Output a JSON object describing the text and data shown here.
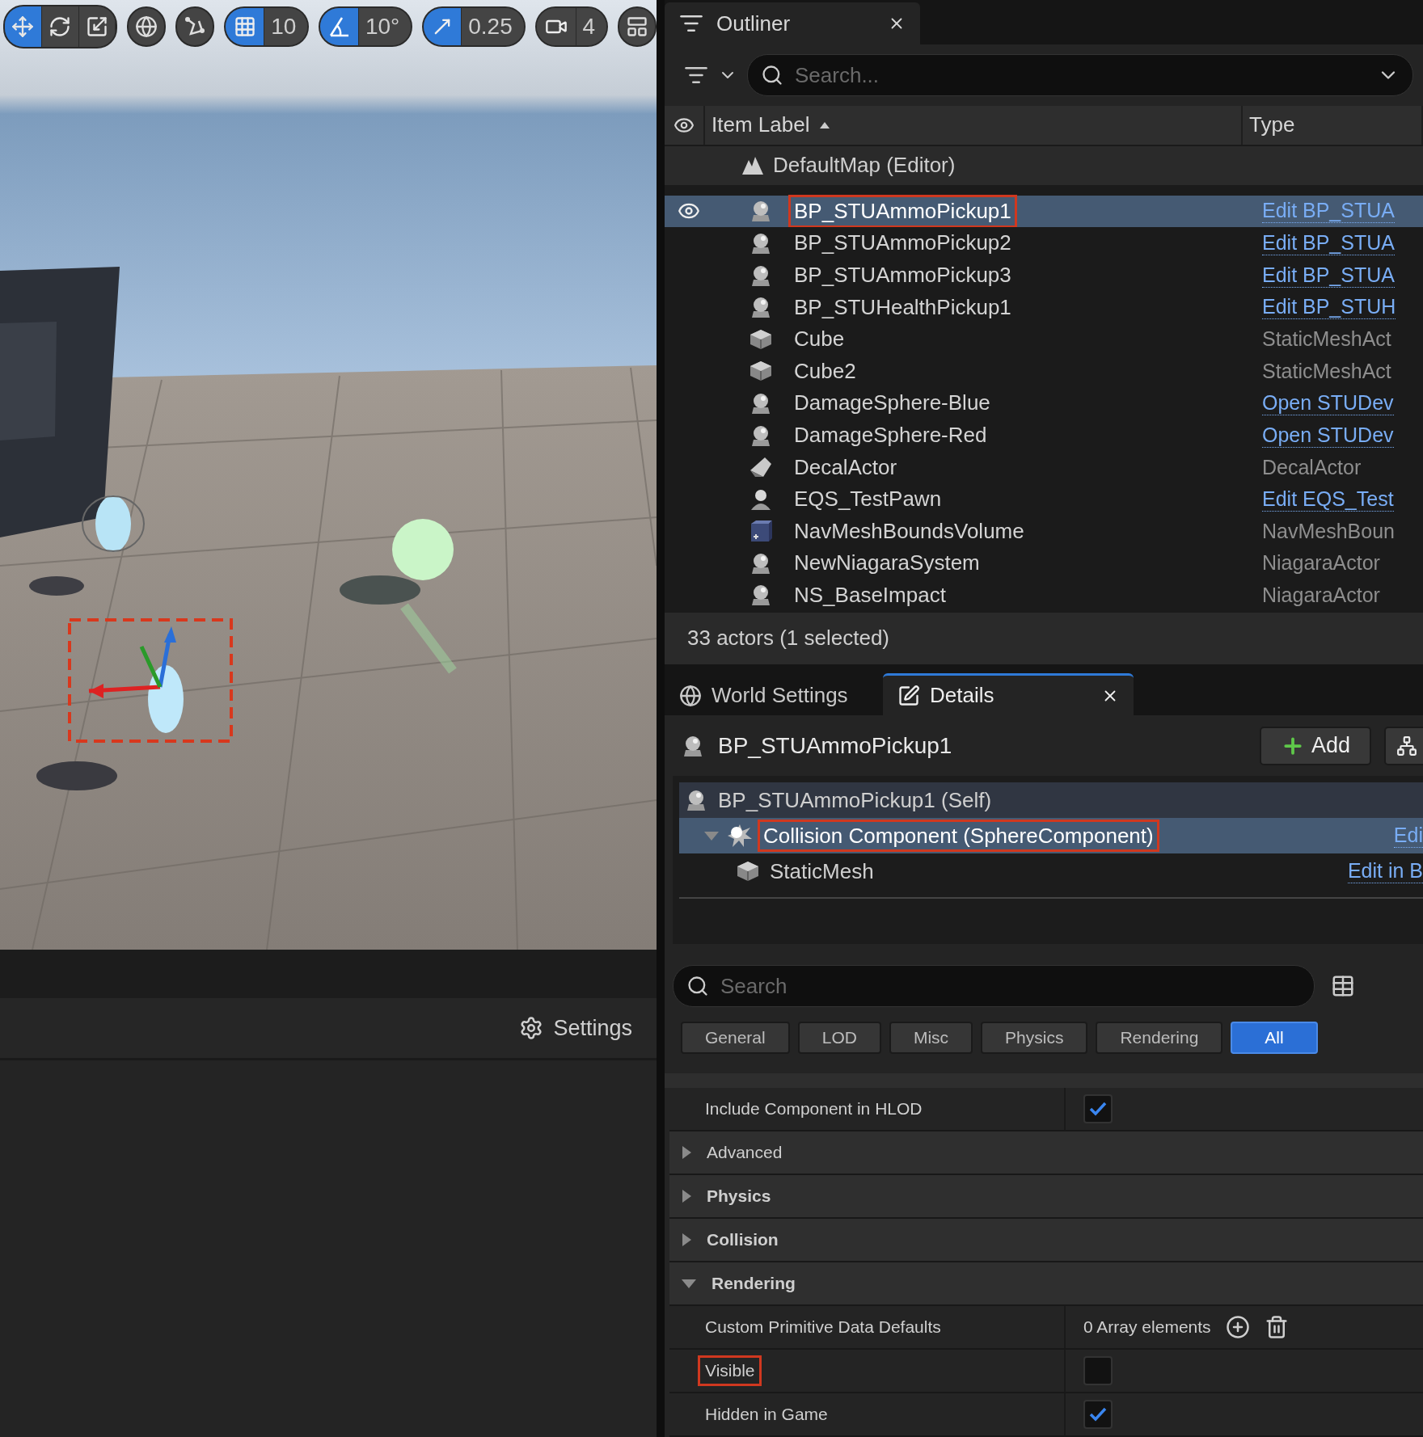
{
  "toolbar": [
    {
      "kind": "modes",
      "items": [
        {
          "selected": true
        },
        {
          "selected": false
        },
        {
          "selected": false
        }
      ]
    },
    {
      "kind": "single"
    },
    {
      "kind": "single"
    },
    {
      "kind": "snap",
      "on": true,
      "value": "10"
    },
    {
      "kind": "snap",
      "on": true,
      "value": "10°"
    },
    {
      "kind": "snap",
      "on": true,
      "value": "0.25"
    },
    {
      "kind": "snap",
      "on": false,
      "value": "4"
    },
    {
      "kind": "single"
    }
  ],
  "viewport_footer": {
    "settings": "Settings"
  },
  "outliner": {
    "tab": "Outliner",
    "search": {
      "placeholder": "Search..."
    },
    "columns": [
      "Item Label",
      "Type"
    ],
    "world": "DefaultMap (Editor)",
    "rows": [
      {
        "kind": "actor",
        "label": "BP_STUAmmoPickup1",
        "type": "Edit BP_STUA",
        "link": true,
        "selected": true,
        "highlighted": true
      },
      {
        "kind": "actor",
        "label": "BP_STUAmmoPickup2",
        "type": "Edit BP_STUA",
        "link": true,
        "selected": false,
        "highlighted": false
      },
      {
        "kind": "actor",
        "label": "BP_STUAmmoPickup3",
        "type": "Edit BP_STUA",
        "link": true,
        "selected": false,
        "highlighted": false
      },
      {
        "kind": "actor",
        "label": "BP_STUHealthPickup1",
        "type": "Edit BP_STUH",
        "link": true,
        "selected": false,
        "highlighted": false
      },
      {
        "kind": "mesh",
        "label": "Cube",
        "type": "StaticMeshAct",
        "link": false,
        "selected": false,
        "highlighted": false
      },
      {
        "kind": "mesh",
        "label": "Cube2",
        "type": "StaticMeshAct",
        "link": false,
        "selected": false,
        "highlighted": false
      },
      {
        "kind": "actor",
        "label": "DamageSphere-Blue",
        "type": "Open STUDev",
        "link": true,
        "selected": false,
        "highlighted": false
      },
      {
        "kind": "actor",
        "label": "DamageSphere-Red",
        "type": "Open STUDev",
        "link": true,
        "selected": false,
        "highlighted": false
      },
      {
        "kind": "decal",
        "label": "DecalActor",
        "type": "DecalActor",
        "link": false,
        "selected": false,
        "highlighted": false
      },
      {
        "kind": "pawn",
        "label": "EQS_TestPawn",
        "type": "Edit EQS_Test",
        "link": true,
        "selected": false,
        "highlighted": false
      },
      {
        "kind": "volume",
        "label": "NavMeshBoundsVolume",
        "type": "NavMeshBoun",
        "link": false,
        "selected": false,
        "highlighted": false
      },
      {
        "kind": "actor",
        "label": "NewNiagaraSystem",
        "type": "NiagaraActor",
        "link": false,
        "selected": false,
        "highlighted": false
      },
      {
        "kind": "actor",
        "label": "NS_BaseImpact",
        "type": "NiagaraActor",
        "link": false,
        "selected": false,
        "highlighted": false
      }
    ],
    "status": "33 actors (1 selected)"
  },
  "details": {
    "tabs": [
      {
        "label": "World Settings",
        "selected": false
      },
      {
        "label": "Details",
        "selected": true
      }
    ],
    "actor": "BP_STUAmmoPickup1",
    "add_button": "Add",
    "components": [
      {
        "kind": "actor",
        "label": "BP_STUAmmoPickup1 (Self)",
        "selected": false,
        "highlighted": false
      },
      {
        "kind": "sphere",
        "label": "Collision Component (SphereComponent)",
        "link": "Edi",
        "selected": true,
        "highlighted": true,
        "expanded": true
      },
      {
        "kind": "mesh",
        "label": "StaticMesh",
        "link": "Edit in B",
        "selected": false,
        "highlighted": false
      }
    ],
    "search": {
      "placeholder": "Search"
    },
    "filters": [
      {
        "label": "General",
        "selected": false
      },
      {
        "label": "LOD",
        "selected": false
      },
      {
        "label": "Misc",
        "selected": false
      },
      {
        "label": "Physics",
        "selected": false
      },
      {
        "label": "Rendering",
        "selected": false
      },
      {
        "label": "All",
        "selected": true
      }
    ],
    "properties": [
      {
        "kind": "checkbox",
        "label": "Include Component in HLOD",
        "checked": true,
        "highlighted": false
      },
      {
        "kind": "category",
        "label": "Advanced",
        "expanded": false,
        "bold": false
      },
      {
        "kind": "category",
        "label": "Physics",
        "expanded": false,
        "bold": true
      },
      {
        "kind": "category",
        "label": "Collision",
        "expanded": false,
        "bold": true
      },
      {
        "kind": "category",
        "label": "Rendering",
        "expanded": true,
        "bold": true
      },
      {
        "kind": "array",
        "label": "Custom Primitive Data Defaults",
        "value": "0 Array elements"
      },
      {
        "kind": "checkbox",
        "label": "Visible",
        "checked": false,
        "highlighted": true
      },
      {
        "kind": "checkbox",
        "label": "Hidden in Game",
        "checked": true,
        "highlighted": false
      }
    ]
  }
}
